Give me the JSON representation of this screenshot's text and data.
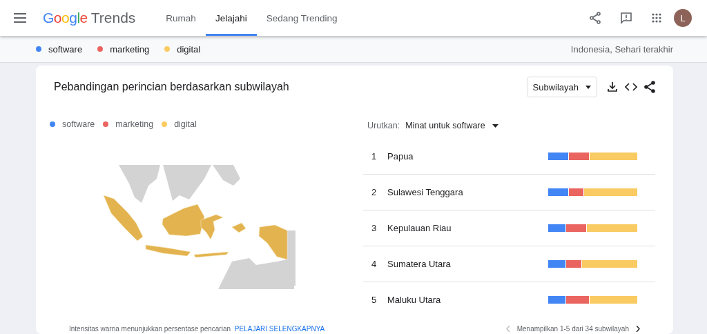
{
  "header": {
    "logo": {
      "brand": [
        "G",
        "o",
        "o",
        "g",
        "l",
        "e"
      ],
      "product": "Trends"
    },
    "nav": [
      {
        "label": "Rumah",
        "selected": false
      },
      {
        "label": "Jelajahi",
        "selected": true
      },
      {
        "label": "Sedang Trending",
        "selected": false
      }
    ],
    "avatar": "L"
  },
  "terms": [
    {
      "label": "software",
      "color": "#4285f4"
    },
    {
      "label": "marketing",
      "color": "#ea6460"
    },
    {
      "label": "digital",
      "color": "#f9cb62"
    }
  ],
  "scope": "Indonesia, Sehari terakhir",
  "card": {
    "title": "Pebandingan perincian berdasarkan subwilayah",
    "dropdown": "Subwilayah",
    "legend": [
      {
        "label": "software",
        "color": "#4285f4"
      },
      {
        "label": "marketing",
        "color": "#ea6460"
      },
      {
        "label": "digital",
        "color": "#f9cb62"
      }
    ],
    "sort_label": "Urutkan:",
    "sort_value": "Minat untuk software",
    "rows": [
      {
        "rank": "1",
        "name": "Papua",
        "segment_ends": [
          {
            "level": 0.23
          },
          {
            "level": 0.46
          },
          {
            "level": 1
          }
        ]
      },
      {
        "rank": "2",
        "name": "Sulawesi Tenggara",
        "segment_ends": [
          {
            "level": 0.23
          },
          {
            "level": 0.4
          },
          {
            "level": 1
          }
        ]
      },
      {
        "rank": "3",
        "name": "Kepulauan Riau",
        "segment_ends": [
          {
            "level": 0.2
          },
          {
            "level": 0.43
          },
          {
            "level": 1
          }
        ]
      },
      {
        "rank": "4",
        "name": "Sumatera Utara",
        "segment_ends": [
          {
            "level": 0.2
          },
          {
            "level": 0.38
          },
          {
            "level": 1
          }
        ]
      },
      {
        "rank": "5",
        "name": "Maluku Utara",
        "segment_ends": [
          {
            "level": 0.2
          },
          {
            "level": 0.46
          },
          {
            "level": 1
          }
        ]
      }
    ],
    "footer_note": "Intensitas warna menunjukkan persentase pencarian",
    "footer_link": "PELAJARI SELENGKAPNYA",
    "pager": "Menampilkan 1-5 dari 34 subwilayah"
  }
}
